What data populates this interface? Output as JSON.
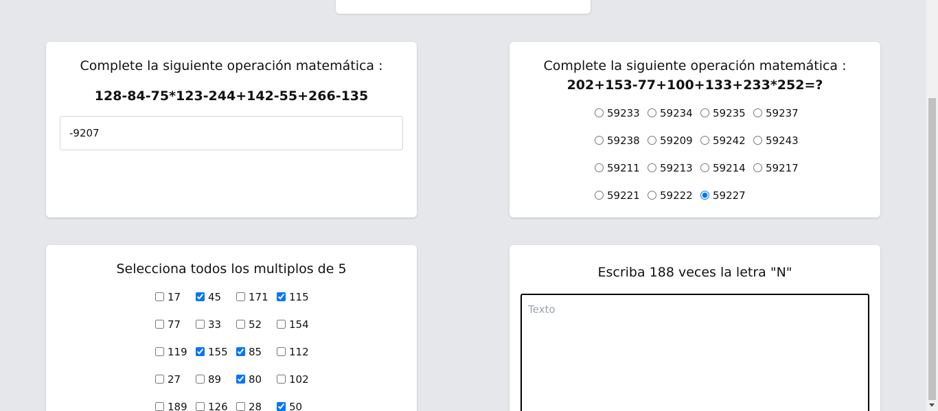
{
  "math_input_card": {
    "prompt": "Complete la siguiente operación matemática :",
    "expression": "128-84-75*123-244+142-55+266-135",
    "answer_value": "-9207"
  },
  "math_radio_card": {
    "prompt": "Complete la siguiente operación matemática :",
    "expression": "202+153-77+100+133+233*252=?",
    "options": [
      [
        "59233",
        "59234",
        "59235",
        "59237"
      ],
      [
        "59238",
        "59209",
        "59242",
        "59243"
      ],
      [
        "59211",
        "59213",
        "59214",
        "59217"
      ],
      [
        "59221",
        "59222",
        "59227"
      ]
    ],
    "selected": "59227"
  },
  "multiples_card": {
    "prompt": "Selecciona todos los multiplos de 5",
    "options": [
      [
        {
          "label": "17",
          "checked": false
        },
        {
          "label": "45",
          "checked": true
        },
        {
          "label": "171",
          "checked": false
        },
        {
          "label": "115",
          "checked": true
        }
      ],
      [
        {
          "label": "77",
          "checked": false
        },
        {
          "label": "33",
          "checked": false
        },
        {
          "label": "52",
          "checked": false
        },
        {
          "label": "154",
          "checked": false
        }
      ],
      [
        {
          "label": "119",
          "checked": false
        },
        {
          "label": "155",
          "checked": true
        },
        {
          "label": "85",
          "checked": true
        },
        {
          "label": "112",
          "checked": false
        }
      ],
      [
        {
          "label": "27",
          "checked": false
        },
        {
          "label": "89",
          "checked": false
        },
        {
          "label": "80",
          "checked": true
        },
        {
          "label": "102",
          "checked": false
        }
      ],
      [
        {
          "label": "189",
          "checked": false
        },
        {
          "label": "126",
          "checked": false
        },
        {
          "label": "28",
          "checked": false
        },
        {
          "label": "50",
          "checked": true
        }
      ]
    ]
  },
  "letters_card": {
    "prompt": "Escriba 188 veces la letra \"N\"",
    "textarea_placeholder": "Texto",
    "textarea_value": ""
  },
  "colors": {
    "background": "#e5e7eb",
    "card": "#ffffff",
    "accent": "#1a73e8"
  }
}
